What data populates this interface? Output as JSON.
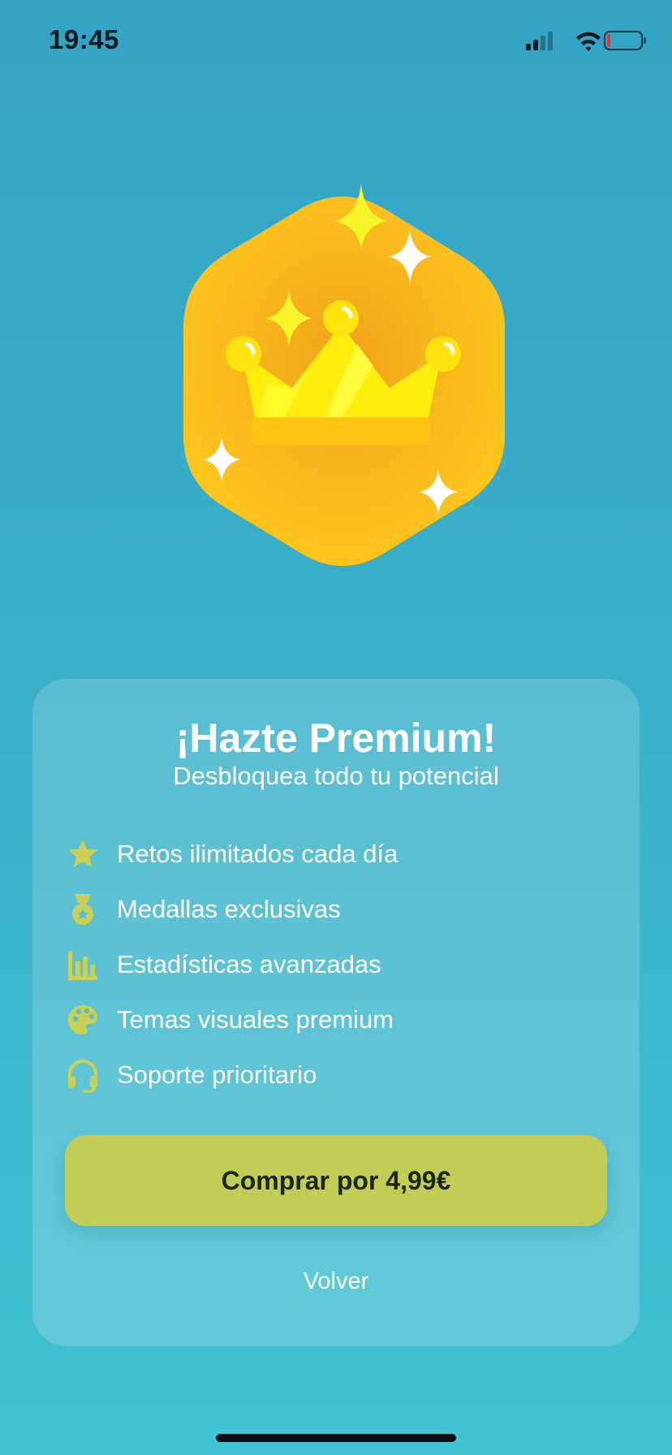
{
  "status_bar": {
    "time": "19:45",
    "icons": [
      "cellular-signal-icon",
      "wifi-icon",
      "battery-low-icon"
    ]
  },
  "hero": {
    "icon": "crown-badge-icon",
    "colors": {
      "badge": "#fdc51d",
      "badge_center": "#eea119",
      "crown": "#ffee0e",
      "sparkle_yellow": "#f6f52a",
      "sparkle_white": "#ffffff"
    }
  },
  "card": {
    "title": "¡Hazte Premium!",
    "subtitle": "Desbloquea todo tu potencial",
    "features": [
      {
        "icon": "star-icon",
        "label": "Retos ilimitados cada día"
      },
      {
        "icon": "medal-icon",
        "label": "Medallas exclusivas"
      },
      {
        "icon": "bar-chart-icon",
        "label": "Estadísticas avanzadas"
      },
      {
        "icon": "palette-icon",
        "label": "Temas visuales premium"
      },
      {
        "icon": "headset-icon",
        "label": "Soporte prioritario"
      }
    ],
    "buy_button": "Comprar por 4,99€",
    "back_link": "Volver"
  },
  "colors": {
    "background_top": "#35a3c4",
    "background_bottom": "#42c2d3",
    "accent": "#c2cd55",
    "icon": "#c8d056",
    "button_text": "#1e2617"
  }
}
